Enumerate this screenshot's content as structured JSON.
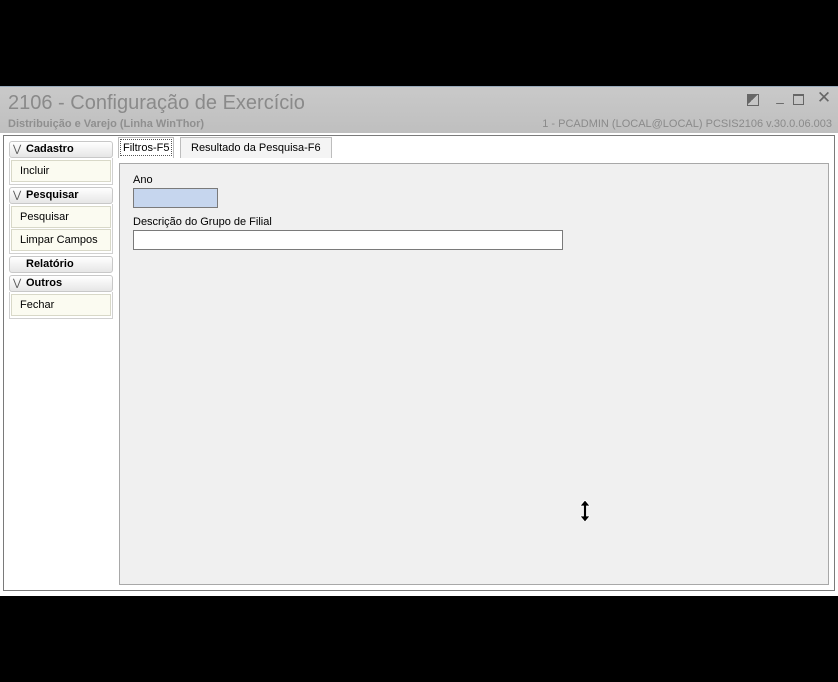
{
  "window": {
    "title": "2106 - Configuração de Exercício",
    "subtitle": "Distribuição e Varejo (Linha WinThor)",
    "session_info": "1 - PCADMIN (LOCAL@LOCAL)   PCSIS2106  v.30.0.06.003",
    "controls": {
      "restore_icon": "restore-icon",
      "minimize_icon": "minimize-icon",
      "maximize_icon": "maximize-icon",
      "close_icon": "close-icon"
    }
  },
  "sidebar": {
    "groups": [
      {
        "label": "Cadastro",
        "items": [
          "Incluir"
        ]
      },
      {
        "label": "Pesquisar",
        "items": [
          "Pesquisar",
          "Limpar Campos"
        ]
      },
      {
        "label": "Relatório",
        "items": []
      },
      {
        "label": "Outros",
        "items": [
          "Fechar"
        ]
      }
    ]
  },
  "tabs": [
    {
      "label": "Filtros-F5",
      "active": true
    },
    {
      "label": "Resultado da Pesquisa-F6",
      "active": false
    }
  ],
  "filters": {
    "ano_label": "Ano",
    "ano_value": "",
    "descricao_label": "Descrição do Grupo de Filial",
    "descricao_value": ""
  }
}
